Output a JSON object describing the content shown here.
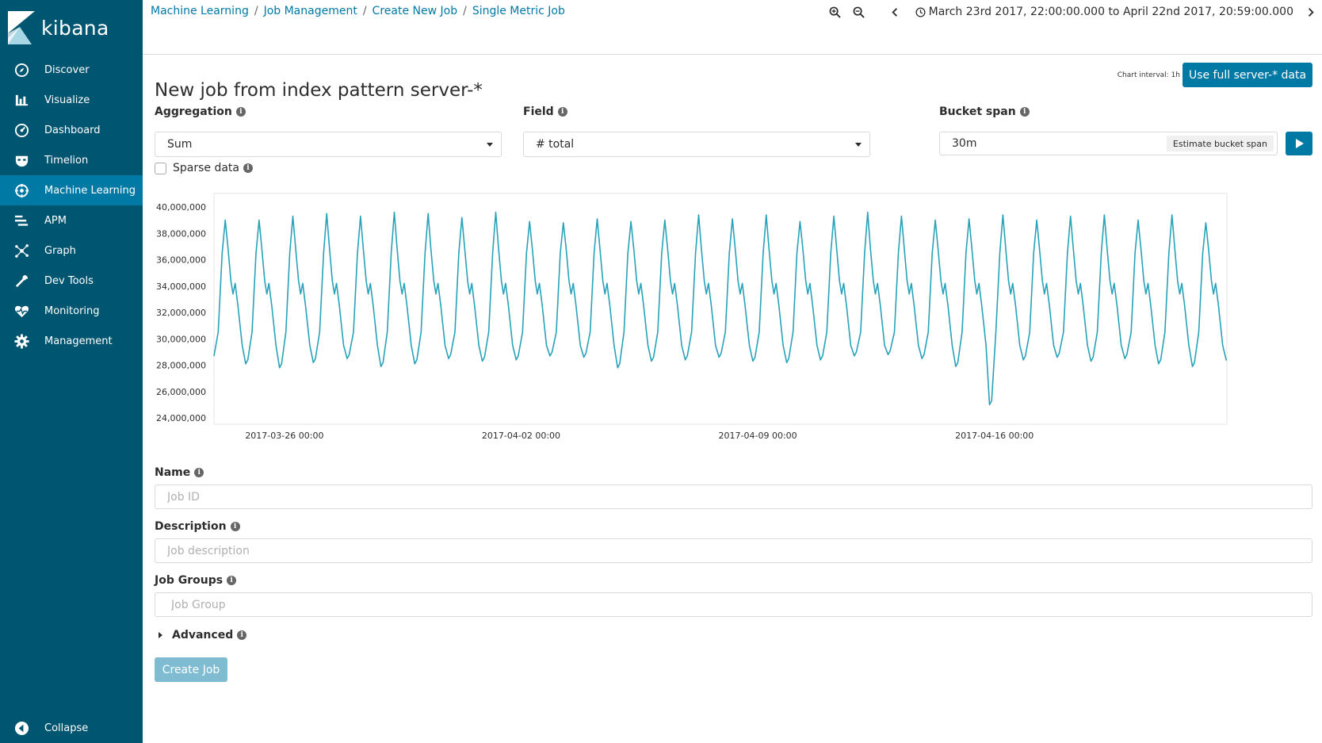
{
  "sidebar": {
    "logo_text": "kibana",
    "items": [
      {
        "label": "Discover",
        "icon": "compass-icon"
      },
      {
        "label": "Visualize",
        "icon": "bar-chart-icon"
      },
      {
        "label": "Dashboard",
        "icon": "dashboard-icon"
      },
      {
        "label": "Timelion",
        "icon": "timelion-mask-icon"
      },
      {
        "label": "Machine Learning",
        "icon": "machine-learning-icon",
        "active": true
      },
      {
        "label": "APM",
        "icon": "apm-icon"
      },
      {
        "label": "Graph",
        "icon": "graph-icon"
      },
      {
        "label": "Dev Tools",
        "icon": "wrench-icon"
      },
      {
        "label": "Monitoring",
        "icon": "heartbeat-icon"
      },
      {
        "label": "Management",
        "icon": "gear-icon"
      }
    ],
    "collapse_label": "Collapse"
  },
  "breadcrumbs": [
    "Machine Learning",
    "Job Management",
    "Create New Job",
    "Single Metric Job"
  ],
  "timepicker": {
    "range": "March 23rd 2017, 22:00:00.000 to April 22nd 2017, 20:59:00.000"
  },
  "page": {
    "title": "New job from index pattern server-*",
    "chart_interval": "Chart interval: 1h",
    "use_full_label": "Use full server-* data",
    "aggregation_label": "Aggregation",
    "aggregation_value": "Sum",
    "field_label": "Field",
    "field_value": "# total",
    "bucket_span_label": "Bucket span",
    "bucket_span_value": "30m",
    "estimate_label": "Estimate bucket span",
    "sparse_label": "Sparse data",
    "name_label": "Name",
    "name_placeholder": "Job ID",
    "description_label": "Description",
    "description_placeholder": "Job description",
    "groups_label": "Job Groups",
    "groups_placeholder": "Job Group",
    "advanced_label": "Advanced",
    "create_label": "Create Job"
  },
  "colors": {
    "sidebar_bg": "#005571",
    "sidebar_active": "#0079a5",
    "accent": "#0079a5",
    "line": "#27a2b9"
  },
  "chart_data": {
    "type": "line",
    "x_range": [
      "2017-03-23 22:00",
      "2017-04-22 20:59"
    ],
    "ylim": [
      24000000,
      40000000
    ],
    "yticks": [
      24000000,
      26000000,
      28000000,
      30000000,
      32000000,
      34000000,
      36000000,
      38000000,
      40000000
    ],
    "ytick_labels": [
      "24,000,000",
      "26,000,000",
      "28,000,000",
      "30,000,000",
      "32,000,000",
      "34,000,000",
      "36,000,000",
      "38,000,000",
      "40,000,000"
    ],
    "xtick_labels": [
      "2017-03-26 00:00",
      "2017-04-02 00:00",
      "2017-04-09 00:00",
      "2017-04-16 00:00"
    ],
    "xtick_dates": [
      "2017-03-26 00:00",
      "2017-04-02 00:00",
      "2017-04-09 00:00",
      "2017-04-16 00:00"
    ],
    "series": [
      {
        "daily_peaks": [
          39000000,
          39000000,
          39300000,
          39500000,
          39300000,
          39600000,
          39500000,
          39200000,
          39600000,
          38900000,
          38800000,
          39100000,
          38900000,
          39000000,
          39400000,
          39100000,
          39400000,
          38900000,
          39300000,
          39600000,
          39300000,
          39000000,
          39100000,
          39400000,
          39000000,
          39300000,
          39400000,
          39000000,
          39400000,
          38800000
        ],
        "daily_troughs": [
          28600000,
          28100000,
          27800000,
          28200000,
          28500000,
          27900000,
          28100000,
          28500000,
          28300000,
          28400000,
          28700000,
          28600000,
          27800000,
          28300000,
          28400000,
          28600000,
          28300000,
          28200000,
          28400000,
          28700000,
          28800000,
          28500000,
          27900000,
          25000000,
          28400000,
          28600000,
          28300000,
          28500000,
          28100000,
          27900000,
          28400000
        ],
        "secondary_plateau": 34000000
      }
    ]
  }
}
